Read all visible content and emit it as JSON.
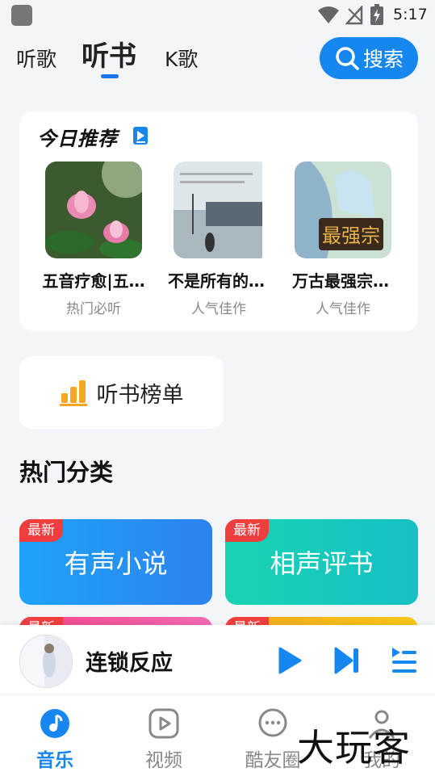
{
  "status_bar": {
    "time": "5:17"
  },
  "top_tabs": [
    {
      "label": "听歌"
    },
    {
      "label": "听书"
    },
    {
      "label": "K歌"
    }
  ],
  "search": {
    "label": "搜索"
  },
  "recommend": {
    "title": "今日推荐",
    "items": [
      {
        "name": "五音疗愈|五…",
        "tag": "热门必听",
        "cover_icon": "lotus-cover"
      },
      {
        "name": "不是所有的…",
        "tag": "人气佳作",
        "cover_icon": "street-photo-cover"
      },
      {
        "name": "万古最强宗…",
        "tag": "人气佳作",
        "cover_icon": "anime-cover"
      }
    ]
  },
  "ranking": {
    "label": "听书榜单",
    "icon": "bar-chart-icon",
    "color": "#f5a623"
  },
  "categories": {
    "title": "热门分类",
    "tiles": [
      {
        "label": "有声小说",
        "badge": "最新",
        "color": "#1f9bf7"
      },
      {
        "label": "相声评书",
        "badge": "最新",
        "color": "#19c9b6"
      },
      {
        "label": "",
        "badge": "最新",
        "color": "#f25d9c"
      },
      {
        "label": "",
        "badge": "最新",
        "color": "#f7b617"
      }
    ]
  },
  "player": {
    "title": "连锁反应"
  },
  "bottom_nav": [
    {
      "label": "音乐",
      "active": true
    },
    {
      "label": "视频",
      "active": false
    },
    {
      "label": "酷友圈",
      "active": false
    },
    {
      "label": "我的",
      "active": false
    }
  ],
  "watermark": "大玩客",
  "colors": {
    "accent": "#1787f0",
    "badge": "#f03e3e"
  }
}
